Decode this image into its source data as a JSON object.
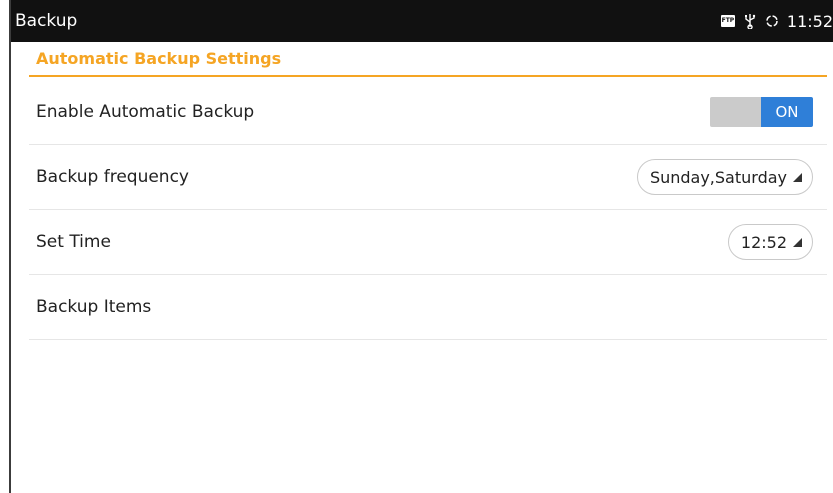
{
  "statusbar": {
    "title": "Backup",
    "icons": [
      "ftp-icon",
      "usb-icon",
      "sync-icon"
    ],
    "ftp_text": "FTP",
    "time": "11:52"
  },
  "section": {
    "title": "Automatic Backup Settings"
  },
  "settings": {
    "enable_backup": {
      "label": "Enable Automatic Backup",
      "toggle_state": "ON"
    },
    "frequency": {
      "label": "Backup frequency",
      "value": "Sunday,Saturday"
    },
    "set_time": {
      "label": "Set Time",
      "value": "12:52"
    },
    "backup_items": {
      "label": "Backup Items"
    }
  },
  "colors": {
    "accent": "#f5a524",
    "toggle_on": "#2f7fd8",
    "statusbar_bg": "#111111"
  }
}
